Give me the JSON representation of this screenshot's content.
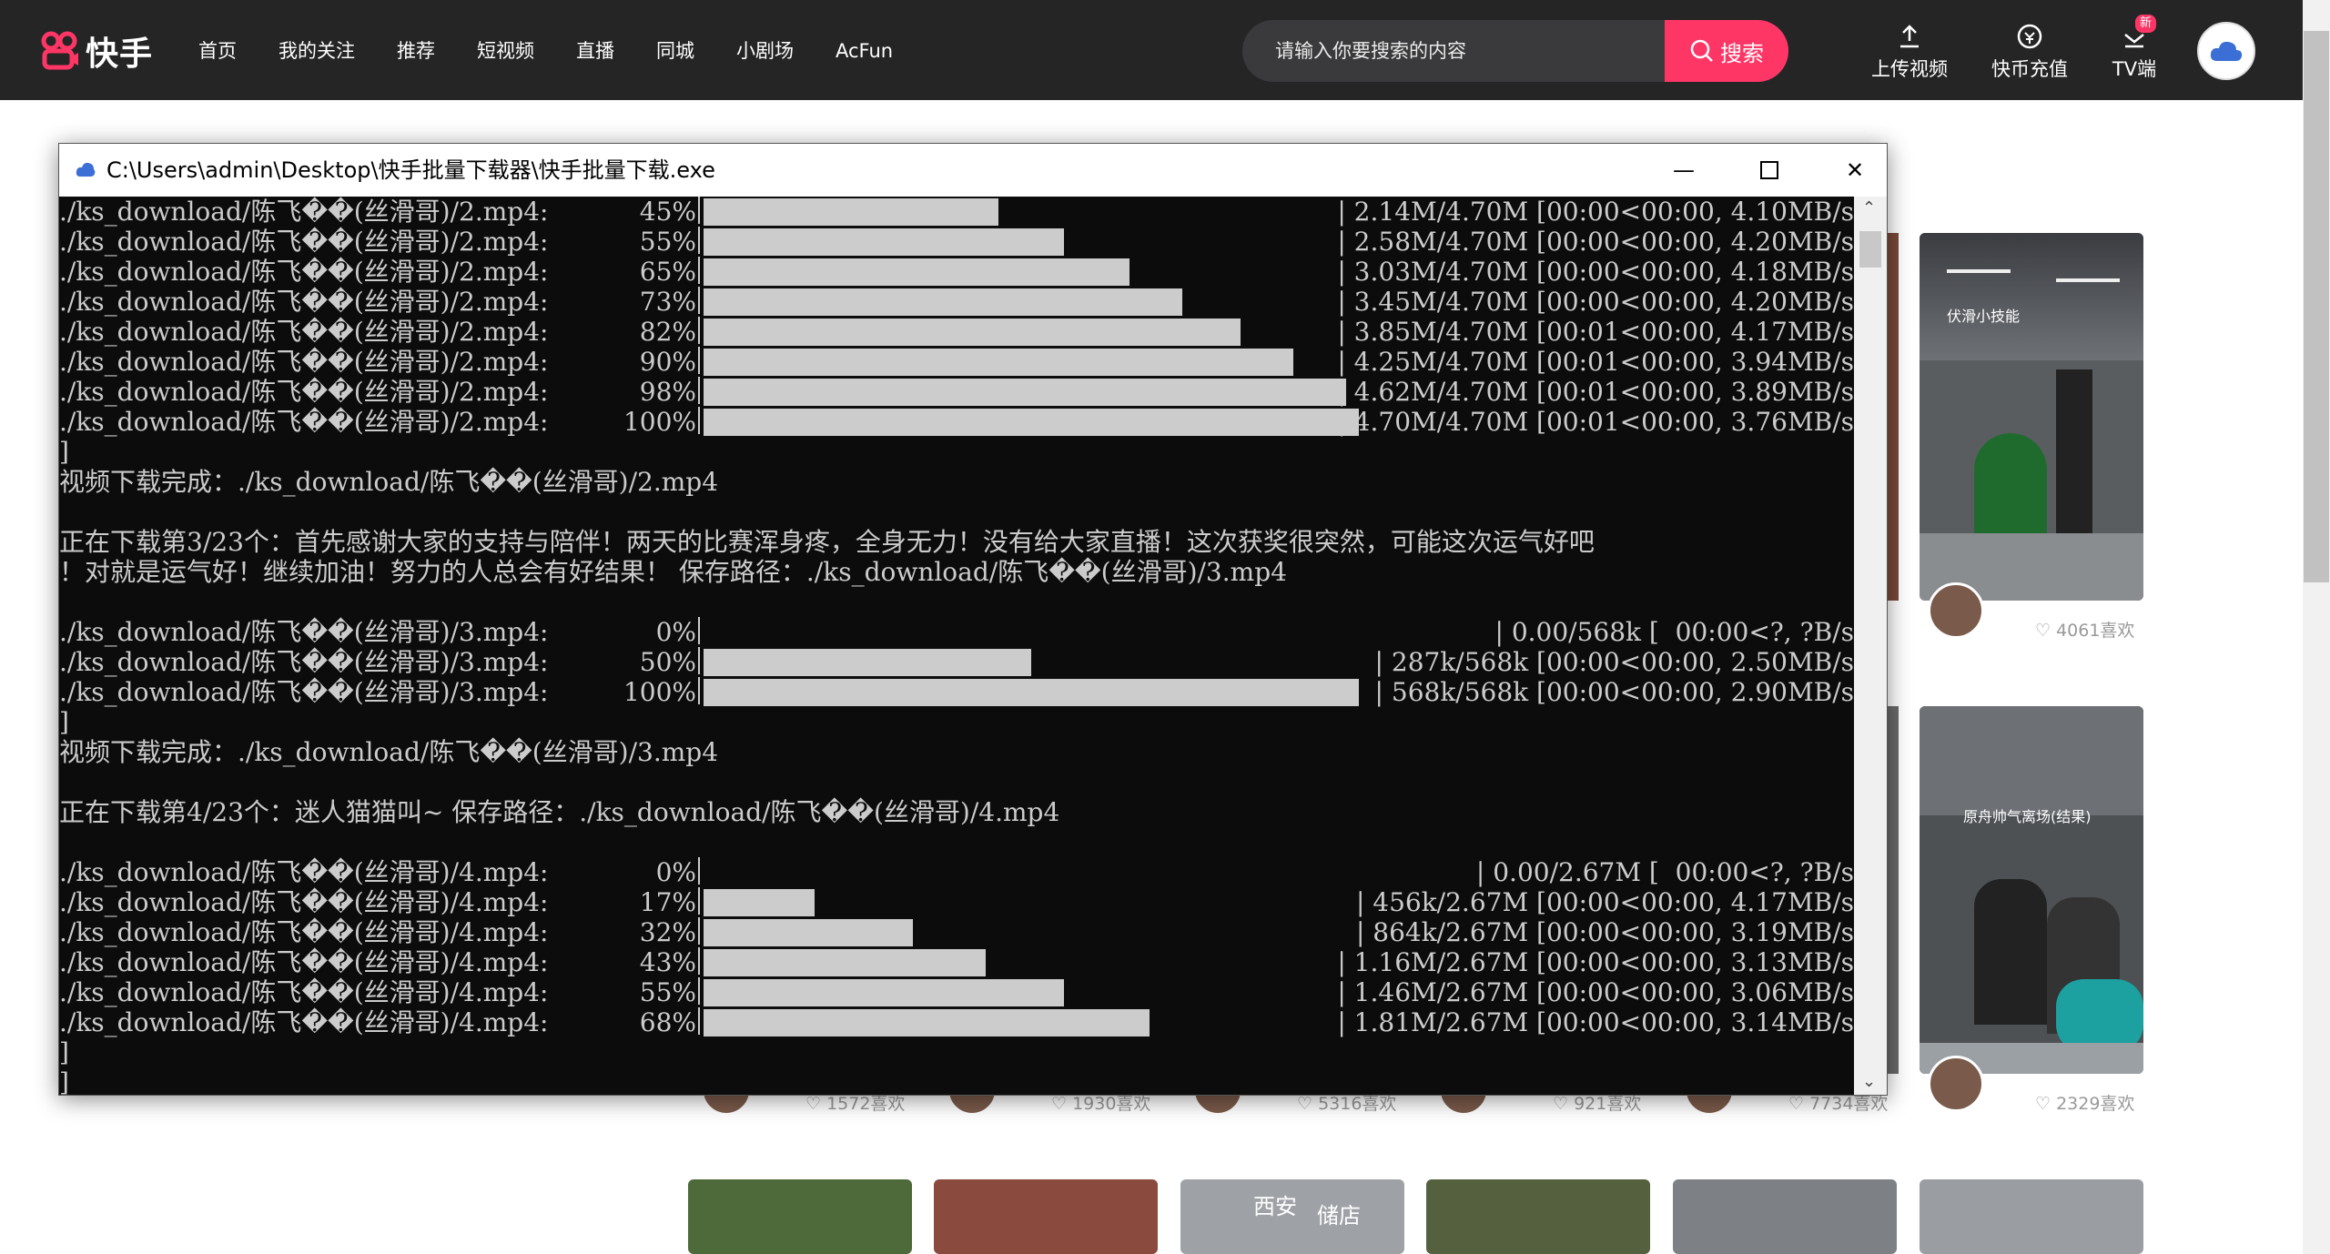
{
  "nav": {
    "logo_text": "快手",
    "items": [
      "首页",
      "我的关注",
      "推荐",
      "短视频",
      "直播",
      "同城",
      "小剧场",
      "AcFun"
    ]
  },
  "search": {
    "placeholder": "请输入你要搜索的内容",
    "button": "搜索"
  },
  "tools": {
    "upload": "上传视频",
    "recharge": "快币充值",
    "tv": "TV端",
    "tv_badge": "新"
  },
  "feed": {
    "likes_right_top": "4061喜欢",
    "likes_right_bottom": "2329喜欢",
    "likes_row": [
      "1572喜欢",
      "1930喜欢",
      "5316喜欢",
      "921喜欢",
      "7734喜欢"
    ],
    "thumb_caption_1": "伏滑小技能",
    "thumb_caption_2": "原舟帅气离场(结果)",
    "thumb_caption_3": "西安",
    "thumb_caption_4": "储店"
  },
  "console": {
    "title": "C:\\Users\\admin\\Desktop\\快手批量下载器\\快手批量下载.exe",
    "lines": [
      {
        "path": "./ks_download/陈飞��(丝滑哥)/2.mp4:",
        "pct": "45%",
        "stat": "2.14M/4.70M [00:00<00:00, 4.10MB/s",
        "fill": 0.45
      },
      {
        "path": "./ks_download/陈飞��(丝滑哥)/2.mp4:",
        "pct": "55%",
        "stat": "2.58M/4.70M [00:00<00:00, 4.20MB/s",
        "fill": 0.55
      },
      {
        "path": "./ks_download/陈飞��(丝滑哥)/2.mp4:",
        "pct": "65%",
        "stat": "3.03M/4.70M [00:00<00:00, 4.18MB/s",
        "fill": 0.65
      },
      {
        "path": "./ks_download/陈飞��(丝滑哥)/2.mp4:",
        "pct": "73%",
        "stat": "3.45M/4.70M [00:00<00:00, 4.20MB/s",
        "fill": 0.73
      },
      {
        "path": "./ks_download/陈飞��(丝滑哥)/2.mp4:",
        "pct": "82%",
        "stat": "3.85M/4.70M [00:01<00:00, 4.17MB/s",
        "fill": 0.82
      },
      {
        "path": "./ks_download/陈飞��(丝滑哥)/2.mp4:",
        "pct": "90%",
        "stat": "4.25M/4.70M [00:01<00:00, 3.94MB/s",
        "fill": 0.9
      },
      {
        "path": "./ks_download/陈飞��(丝滑哥)/2.mp4:",
        "pct": "98%",
        "stat": "4.62M/4.70M [00:01<00:00, 3.89MB/s",
        "fill": 0.98
      },
      {
        "path": "./ks_download/陈飞��(丝滑哥)/2.mp4:",
        "pct": "100%",
        "stat": "4.70M/4.70M [00:01<00:00, 3.76MB/s",
        "fill": 1.0
      }
    ],
    "done_2": "视频下载完成：./ks_download/陈飞��(丝滑哥)/2.mp4",
    "start_3a": "正在下载第3/23个：首先感谢大家的支持与陪伴！两天的比赛浑身疼，全身无力！没有给大家直播！这次获奖很突然，可能这次运气好吧",
    "start_3b": "！对就是运气好！继续加油！努力的人总会有好结果！ 保存路径：./ks_download/陈飞��(丝滑哥)/3.mp4",
    "lines3": [
      {
        "path": "./ks_download/陈飞��(丝滑哥)/3.mp4:",
        "pct": "0%",
        "stat": "0.00/568k [  00:00<?, ?B/s",
        "fill": 0.0
      },
      {
        "path": "./ks_download/陈飞��(丝滑哥)/3.mp4:",
        "pct": "50%",
        "stat": "287k/568k [00:00<00:00, 2.50MB/s",
        "fill": 0.5
      },
      {
        "path": "./ks_download/陈飞��(丝滑哥)/3.mp4:",
        "pct": "100%",
        "stat": "568k/568k [00:00<00:00, 2.90MB/s",
        "fill": 1.0
      }
    ],
    "done_3": "视频下载完成：./ks_download/陈飞��(丝滑哥)/3.mp4",
    "start_4": "正在下载第4/23个：迷人猫猫叫~ 保存路径：./ks_download/陈飞��(丝滑哥)/4.mp4",
    "lines4": [
      {
        "path": "./ks_download/陈飞��(丝滑哥)/4.mp4:",
        "pct": "0%",
        "stat": "0.00/2.67M [  00:00<?, ?B/s",
        "fill": 0.0
      },
      {
        "path": "./ks_download/陈飞��(丝滑哥)/4.mp4:",
        "pct": "17%",
        "stat": "456k/2.67M [00:00<00:00, 4.17MB/s",
        "fill": 0.17
      },
      {
        "path": "./ks_download/陈飞��(丝滑哥)/4.mp4:",
        "pct": "32%",
        "stat": "864k/2.67M [00:00<00:00, 3.19MB/s",
        "fill": 0.32
      },
      {
        "path": "./ks_download/陈飞��(丝滑哥)/4.mp4:",
        "pct": "43%",
        "stat": "1.16M/2.67M [00:00<00:00, 3.13MB/s",
        "fill": 0.43
      },
      {
        "path": "./ks_download/陈飞��(丝滑哥)/4.mp4:",
        "pct": "55%",
        "stat": "1.46M/2.67M [00:00<00:00, 3.06MB/s",
        "fill": 0.55
      },
      {
        "path": "./ks_download/陈飞��(丝滑哥)/4.mp4:",
        "pct": "68%",
        "stat": "1.81M/2.67M [00:00<00:00, 3.14MB/s",
        "fill": 0.68
      }
    ]
  },
  "colors": {
    "accent": "#fe3666",
    "topbar": "#252526",
    "console_bg": "#0c0c0c",
    "console_fg": "#cccccc"
  }
}
